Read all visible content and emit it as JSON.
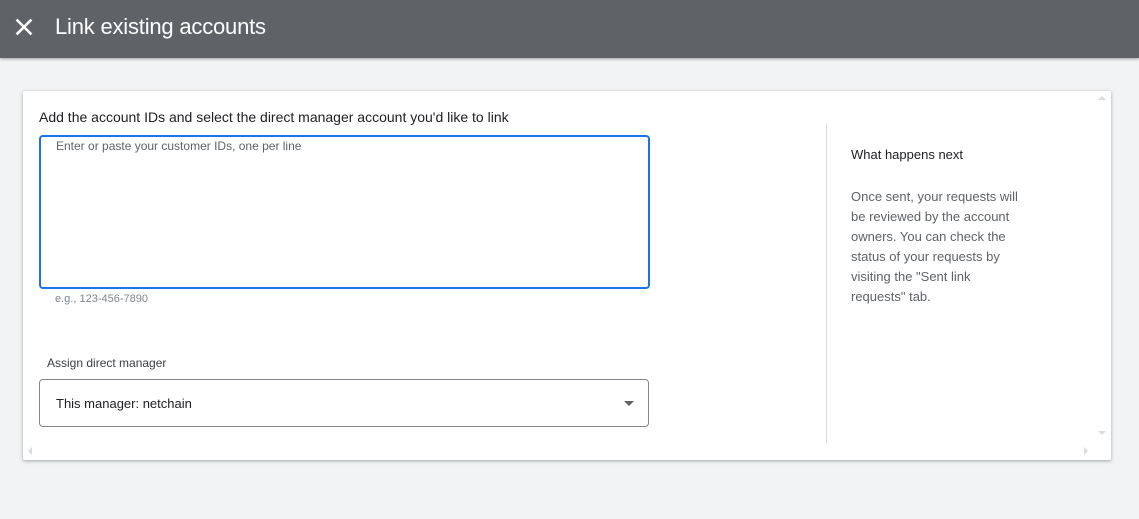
{
  "header": {
    "title": "Link existing accounts",
    "close_icon": "close-icon",
    "background": "#5f6368"
  },
  "form": {
    "instruction": "Add the account IDs and select the direct manager account you'd like to link",
    "customer_ids": {
      "placeholder": "Enter or paste your customer IDs, one per line",
      "value": "",
      "hint": "e.g., 123-456-7890"
    },
    "direct_manager": {
      "label": "Assign direct manager",
      "selected": "This manager: netchain",
      "caret_icon": "caret-down-icon"
    }
  },
  "info": {
    "title": "What happens next",
    "body": "Once sent, your requests will be reviewed by the account owners. You can check the status of your requests by visiting the \"Sent link requests\" tab."
  },
  "colors": {
    "accent": "#1a73e8",
    "page_background": "#f1f3f4"
  }
}
